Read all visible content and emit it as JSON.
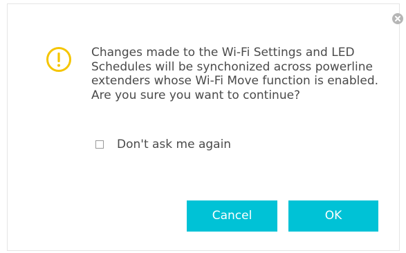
{
  "dialog": {
    "message": "Changes made to the Wi-Fi Settings and LED Schedules will be synchonized across powerline extenders whose Wi-Fi Move function is enabled. Are you sure you want to continue?",
    "checkbox_label": "Don't ask me again",
    "checkbox_checked": false,
    "cancel_label": "Cancel",
    "ok_label": "OK",
    "icons": {
      "warning": "warning-icon",
      "close": "close-icon"
    }
  },
  "colors": {
    "accent": "#00c2d6",
    "warning": "#f5c500",
    "text": "#4a4a4a",
    "close": "#b6b6b6"
  }
}
